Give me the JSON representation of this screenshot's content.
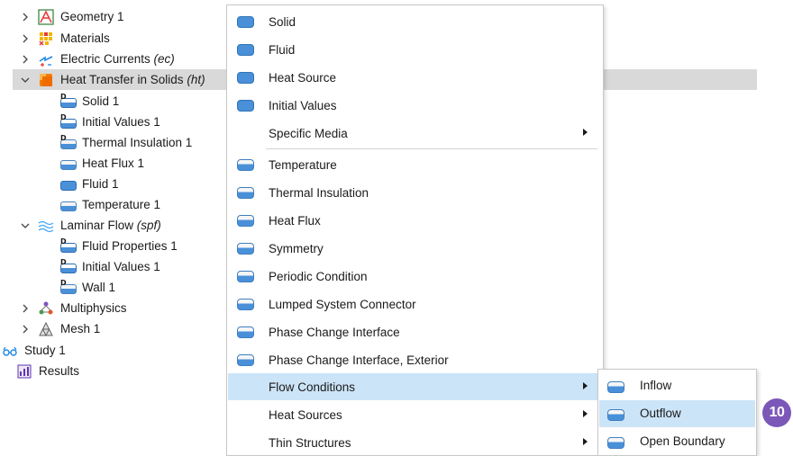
{
  "tree": {
    "geometry": "Geometry 1",
    "materials": "Materials",
    "electric_currents": {
      "name": "Electric Currents",
      "tag": "(ec)"
    },
    "heat_transfer": {
      "name": "Heat Transfer in Solids",
      "tag": "(ht)"
    },
    "ht_children": [
      "Solid 1",
      "Initial Values 1",
      "Thermal Insulation 1",
      "Heat Flux 1",
      "Fluid 1",
      "Temperature 1"
    ],
    "laminar_flow": {
      "name": "Laminar Flow",
      "tag": "(spf)"
    },
    "spf_children": [
      "Fluid Properties 1",
      "Initial Values 1",
      "Wall 1"
    ],
    "multiphysics": "Multiphysics",
    "mesh": "Mesh 1",
    "study": "Study 1",
    "results": "Results"
  },
  "menu": {
    "domain_items": [
      "Solid",
      "Fluid",
      "Heat Source",
      "Initial Values"
    ],
    "specific_media": "Specific Media",
    "boundary_items": [
      "Temperature",
      "Thermal Insulation",
      "Heat Flux",
      "Symmetry",
      "Periodic Condition",
      "Lumped System Connector",
      "Phase Change Interface",
      "Phase Change Interface, Exterior"
    ],
    "submenus": [
      "Flow Conditions",
      "Heat Sources",
      "Thin Structures"
    ]
  },
  "submenu": {
    "items": [
      "Inflow",
      "Outflow",
      "Open Boundary"
    ]
  },
  "badge": "10",
  "colors": {
    "highlight": "#cce4f7",
    "selected_row": "#d9d9d9",
    "icon_blue": "#4a90d9",
    "badge": "#7b57b8"
  }
}
